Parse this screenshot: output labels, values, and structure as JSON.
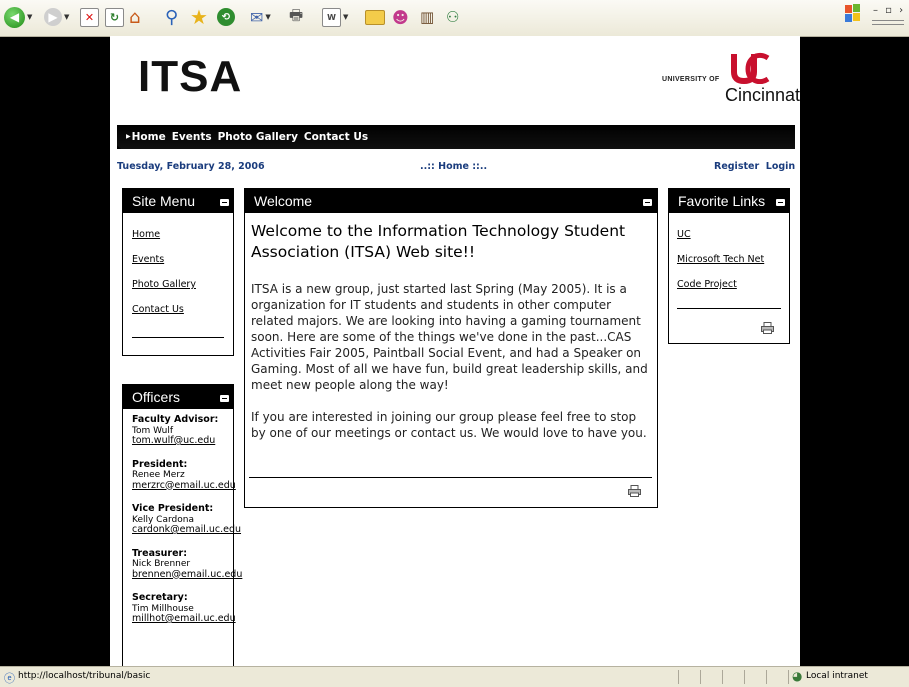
{
  "toolbar": {
    "buttons": [
      "back-icon",
      "forward-icon",
      "stop-icon",
      "refresh-icon",
      "home-icon",
      "search-icon",
      "favorites-icon",
      "history-icon",
      "mail-icon",
      "print-icon",
      "edit-icon",
      "folder-icon",
      "messenger-icon",
      "research-icon",
      "users-icon"
    ]
  },
  "site": {
    "logo": "ITSA",
    "university_of": "UNIVERSITY OF",
    "university_name": "Cincinnati",
    "nav": [
      "Home",
      "Events",
      "Photo Gallery",
      "Contact Us"
    ],
    "date": "Tuesday, February 28, 2006",
    "breadcrumb": "..:: Home ::..",
    "register": "Register",
    "login": "Login"
  },
  "site_menu": {
    "title": "Site Menu",
    "items": [
      "Home",
      "Events",
      "Photo Gallery",
      "Contact Us"
    ]
  },
  "officers": {
    "title": "Officers",
    "list": [
      {
        "role": "Faculty Advisor:",
        "name": "Tom Wulf",
        "email": "tom.wulf@uc.edu"
      },
      {
        "role": "President:",
        "name": "Renee Merz",
        "email": "merzrc@email.uc.edu"
      },
      {
        "role": "Vice President:",
        "name": "Kelly Cardona",
        "email": "cardonk@email.uc.edu"
      },
      {
        "role": "Treasurer:",
        "name": "Nick Brenner",
        "email": "brennen@email.uc.edu"
      },
      {
        "role": "Secretary:",
        "name": "Tim Millhouse",
        "email": "millhot@email.uc.edu"
      }
    ]
  },
  "welcome": {
    "title": "Welcome",
    "heading": "Welcome to the Information Technology Student Association (ITSA) Web site!!",
    "para1": "ITSA is a new group, just started last Spring (May 2005). It is a organization for IT students and students in other computer related majors. We are looking into having a gaming tournament soon. Here are some of the things we've done in the past...CAS Activities Fair 2005, Paintball Social Event, and had a Speaker on Gaming. Most of all we have fun, build great leadership skills, and meet new people along the way!",
    "para2": "If you are interested in joining our group please feel free to stop by one of our meetings or contact us. We would love to have you."
  },
  "favorites": {
    "title": "Favorite Links",
    "items": [
      "UC",
      "Microsoft Tech Net",
      "Code Project"
    ]
  },
  "status": {
    "url": "http://localhost/tribunal/basic",
    "zone": "Local intranet"
  },
  "colors": {
    "header_bg": "#000000",
    "accent_link": "#1a3c7d",
    "uc_red": "#c8102e"
  }
}
